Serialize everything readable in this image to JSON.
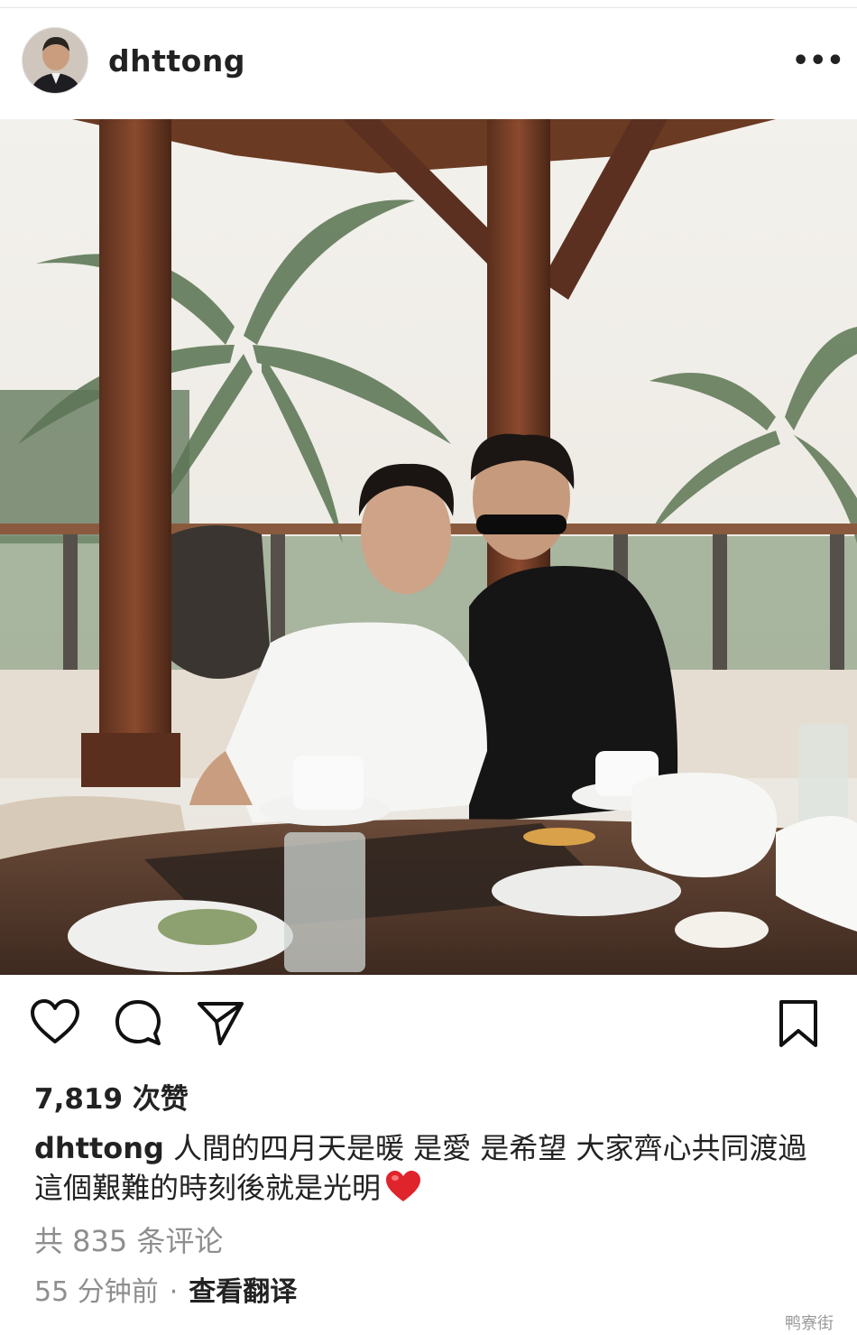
{
  "header": {
    "username": "dhttong",
    "more_label": "•••"
  },
  "post": {
    "likes": "7,819 次赞",
    "caption_user": "dhttong",
    "caption_text": "人間的四月天是暖 是愛 是希望 大家齊心共同渡過這個艱難的時刻後就是光明",
    "caption_emoji": "❤️",
    "comments": "共 835 条评论",
    "time": "55 分钟前",
    "separator": "·",
    "translate": "查看翻译"
  },
  "icons": {
    "more": "more-icon",
    "like": "heart-icon",
    "comment": "comment-icon",
    "share": "send-icon",
    "save": "bookmark-icon"
  },
  "colors": {
    "text": "#222222",
    "secondary": "#8e8e8e",
    "emoji_heart": "#e0242b"
  },
  "watermark": "鸭寮街"
}
